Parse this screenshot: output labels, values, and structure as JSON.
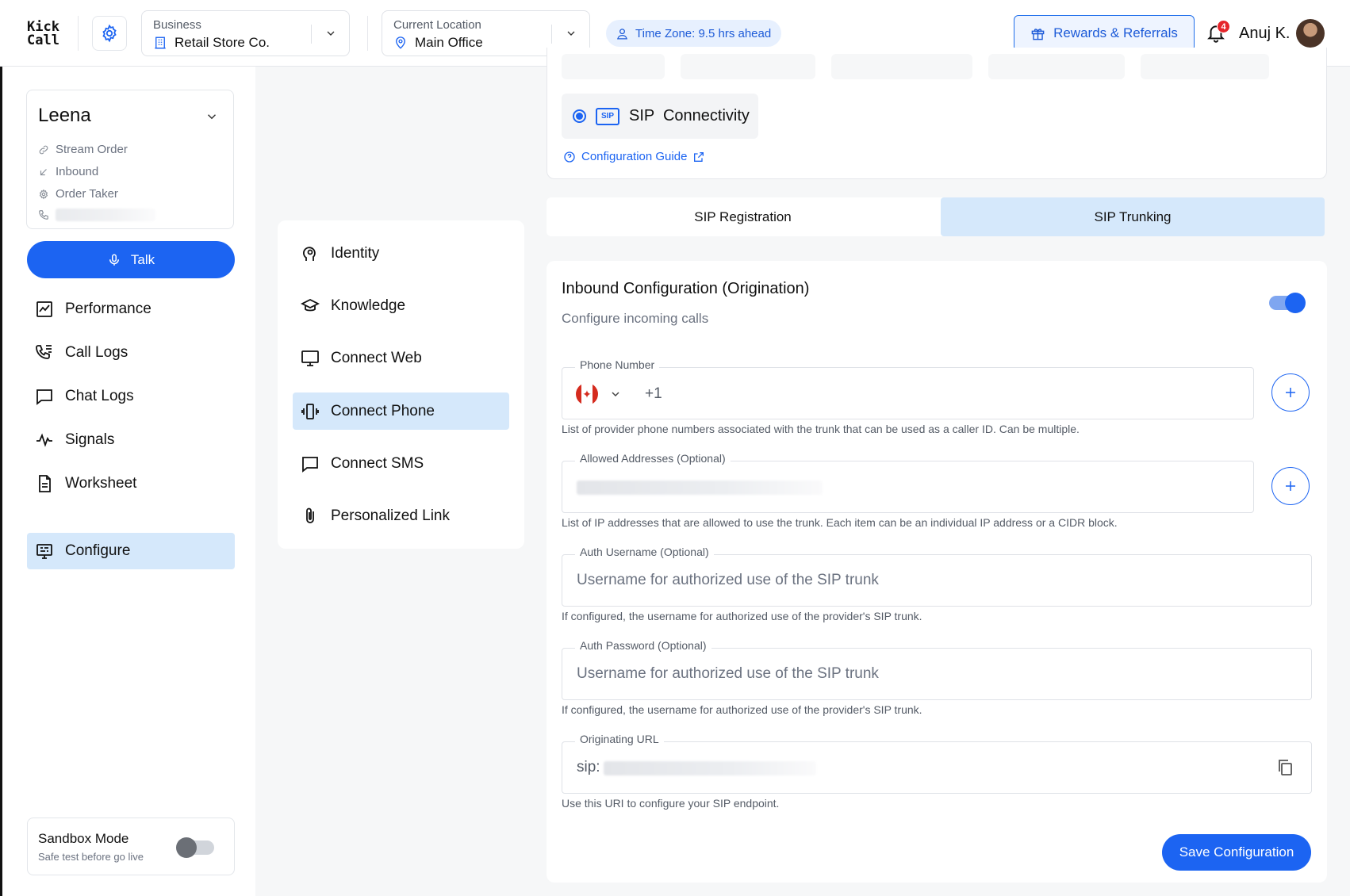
{
  "header": {
    "logo_line1": "Kick",
    "logo_line2": "Call",
    "business": {
      "label": "Business",
      "value": "Retail Store Co."
    },
    "location": {
      "label": "Current Location",
      "value": "Main Office"
    },
    "timezone": "Time Zone: 9.5 hrs ahead",
    "rewards_label": "Rewards & Referrals",
    "notification_count": "4",
    "user_name": "Anuj K."
  },
  "agent": {
    "name": "Leena",
    "meta": [
      "Stream Order",
      "Inbound",
      "Order Taker"
    ]
  },
  "talk_label": "Talk",
  "nav": [
    {
      "label": "Performance",
      "icon": "chart-line-icon"
    },
    {
      "label": "Call Logs",
      "icon": "phone-list-icon"
    },
    {
      "label": "Chat Logs",
      "icon": "chat-bubble-icon"
    },
    {
      "label": "Signals",
      "icon": "pulse-icon"
    },
    {
      "label": "Worksheet",
      "icon": "document-icon"
    },
    {
      "label": "Configure",
      "icon": "monitor-settings-icon",
      "active": true
    }
  ],
  "sandbox": {
    "title": "Sandbox Mode",
    "subtitle": "Safe test before go live",
    "enabled": false
  },
  "subnav": [
    {
      "label": "Identity",
      "icon": "head-icon"
    },
    {
      "label": "Knowledge",
      "icon": "graduation-cap-icon"
    },
    {
      "label": "Connect Web",
      "icon": "monitor-icon"
    },
    {
      "label": "Connect Phone",
      "icon": "phone-vibrate-icon",
      "active": true
    },
    {
      "label": "Connect SMS",
      "icon": "message-icon"
    },
    {
      "label": "Personalized Link",
      "icon": "paperclip-icon"
    }
  ],
  "connectivity": {
    "badge": "SIP",
    "label": "SIP  Connectivity",
    "guide_link": "Configuration Guide"
  },
  "tabs": [
    {
      "label": "SIP Registration",
      "active": false
    },
    {
      "label": "SIP Trunking",
      "active": true
    }
  ],
  "inbound": {
    "title": "Inbound Configuration (Origination)",
    "subtitle": "Configure incoming calls",
    "enabled": true,
    "phone": {
      "legend": "Phone Number",
      "dial_code": "+1",
      "helper": "List of provider phone numbers associated with the trunk that can be used as a caller ID. Can be multiple."
    },
    "allowed": {
      "legend": "Allowed Addresses (Optional)",
      "helper": "List of IP addresses that are allowed to use the trunk. Each item can be an individual IP address or a CIDR block."
    },
    "auth_user": {
      "legend": "Auth Username (Optional)",
      "placeholder": "Username for authorized use of the SIP trunk",
      "helper": "If configured, the username for authorized use of the provider's SIP trunk."
    },
    "auth_pass": {
      "legend": "Auth Password (Optional)",
      "placeholder": "Username for authorized use of the SIP trunk",
      "helper": "If configured, the username for authorized use of the provider's SIP trunk."
    },
    "orig_url": {
      "legend": "Originating URL",
      "prefix": "sip:",
      "helper": "Use this URI to configure your SIP endpoint."
    },
    "save_label": "Save Configuration"
  },
  "colors": {
    "primary": "#1c64f2",
    "active_bg": "#d5e8fb",
    "page_bg": "#f6f7f8"
  }
}
